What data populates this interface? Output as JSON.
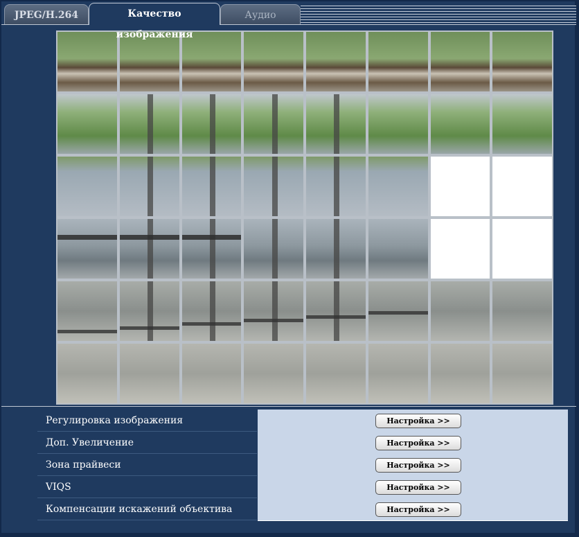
{
  "tabs": [
    {
      "label": "JPEG/H.264",
      "state": "inactive"
    },
    {
      "label": "Качество изображения",
      "state": "active"
    },
    {
      "label": "Аудио",
      "state": "inactive"
    }
  ],
  "image_grid": {
    "rows": 6,
    "cols": 8,
    "masked_cells": [
      [
        2,
        6
      ],
      [
        2,
        7
      ],
      [
        3,
        6
      ],
      [
        3,
        7
      ]
    ]
  },
  "settings": [
    {
      "label": "Регулировка изображения",
      "button": "Настройка >>"
    },
    {
      "label": "Доп. Увеличение",
      "button": "Настройка >>"
    },
    {
      "label": "Зона прайвеси",
      "button": "Настройка >>"
    },
    {
      "label": "VIQS",
      "button": "Настройка >>"
    },
    {
      "label": "Компенсации искажений объектива",
      "button": "Настройка >>"
    }
  ],
  "colors": {
    "panel_bg": "#1f3a5f",
    "value_bg": "#c9d6e8",
    "grid_line": "#b9c0c8",
    "masked": "#ffffff"
  }
}
